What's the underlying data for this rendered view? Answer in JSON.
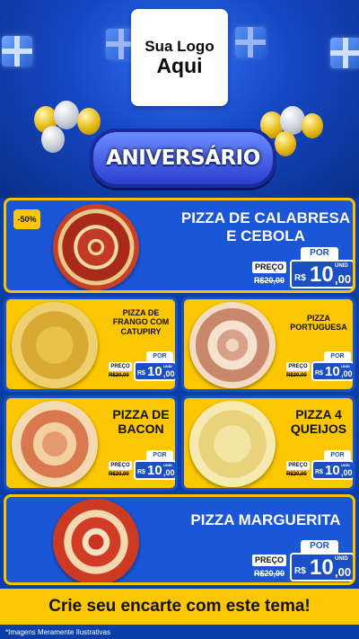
{
  "logo": {
    "line1": "Sua Logo",
    "line2": "Aqui"
  },
  "banner": "ANIVERSÁRIO",
  "common": {
    "por": "POR",
    "preco": "PREÇO",
    "old_price": "R$20,00",
    "currency": "R$",
    "unit": "UNID"
  },
  "featured": {
    "badge": "-50%",
    "name_line1": "PIZZA DE CALABRESA",
    "name_line2": "E CEBOLA",
    "price_int": "10",
    "price_dec": ",00"
  },
  "items": [
    {
      "name": [
        "PIZZA DE",
        "FRANGO COM",
        "CATUPIRY"
      ],
      "price_int": "10",
      "price_dec": ",00"
    },
    {
      "name": [
        "PIZZA",
        "PORTUGUESA"
      ],
      "price_int": "10",
      "price_dec": ",00"
    },
    {
      "name": [
        "PIZZA DE",
        "BACON"
      ],
      "price_int": "10",
      "price_dec": ",00"
    },
    {
      "name": [
        "PIZZA 4",
        "QUEIJOS"
      ],
      "price_int": "10",
      "price_dec": ",00"
    }
  ],
  "bottom": {
    "name": "PIZZA MARGUERITA",
    "price_int": "10",
    "price_dec": ",00"
  },
  "cta": "Crie seu encarte com este tema!",
  "disclaimer": "*Imagens Meramente Ilustrativas",
  "colors": {
    "blue": "#1a56d6",
    "yellow": "#fcc700",
    "dark_blue": "#0b3fa8"
  }
}
